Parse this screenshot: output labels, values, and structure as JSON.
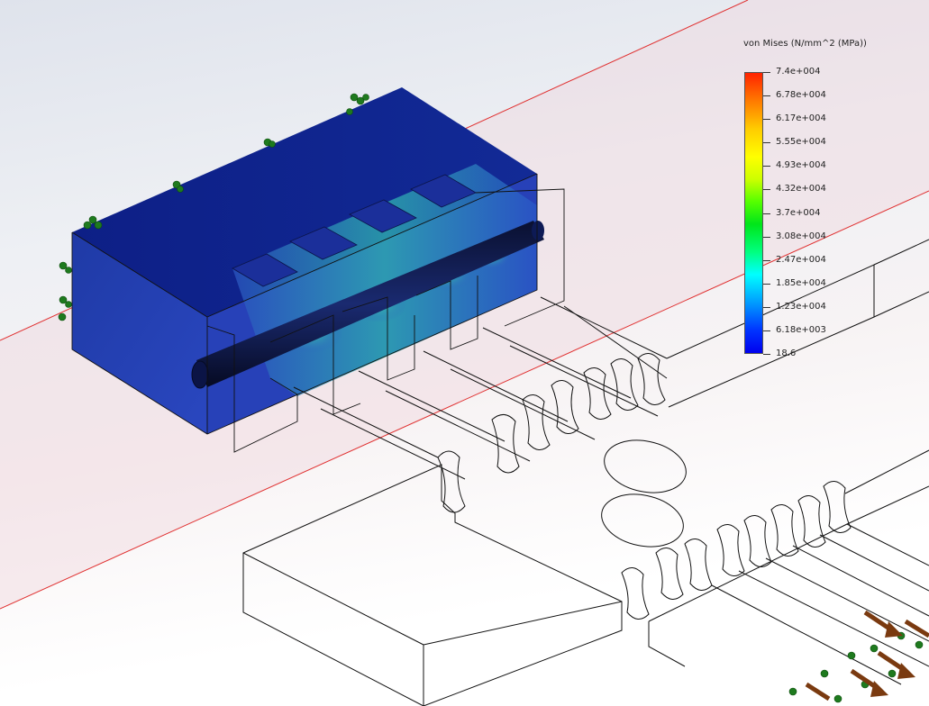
{
  "legend": {
    "title": "von Mises (N/mm^2 (MPa))",
    "labels": [
      "7.4e+004",
      "6.78e+004",
      "6.17e+004",
      "5.55e+004",
      "4.93e+004",
      "4.32e+004",
      "3.7e+004",
      "3.08e+004",
      "2.47e+004",
      "1.85e+004",
      "1.23e+004",
      "6.18e+003",
      "18.6"
    ]
  },
  "colors": {
    "part_dark": "#0a1f8a",
    "part_mid": "#1d3fb0",
    "section_plane": "#e03030",
    "fixture_arrow": "#1e7a1e",
    "load_arrow": "#7a3a10",
    "scale_max": "#ff2200",
    "scale_min": "#0000ee"
  }
}
